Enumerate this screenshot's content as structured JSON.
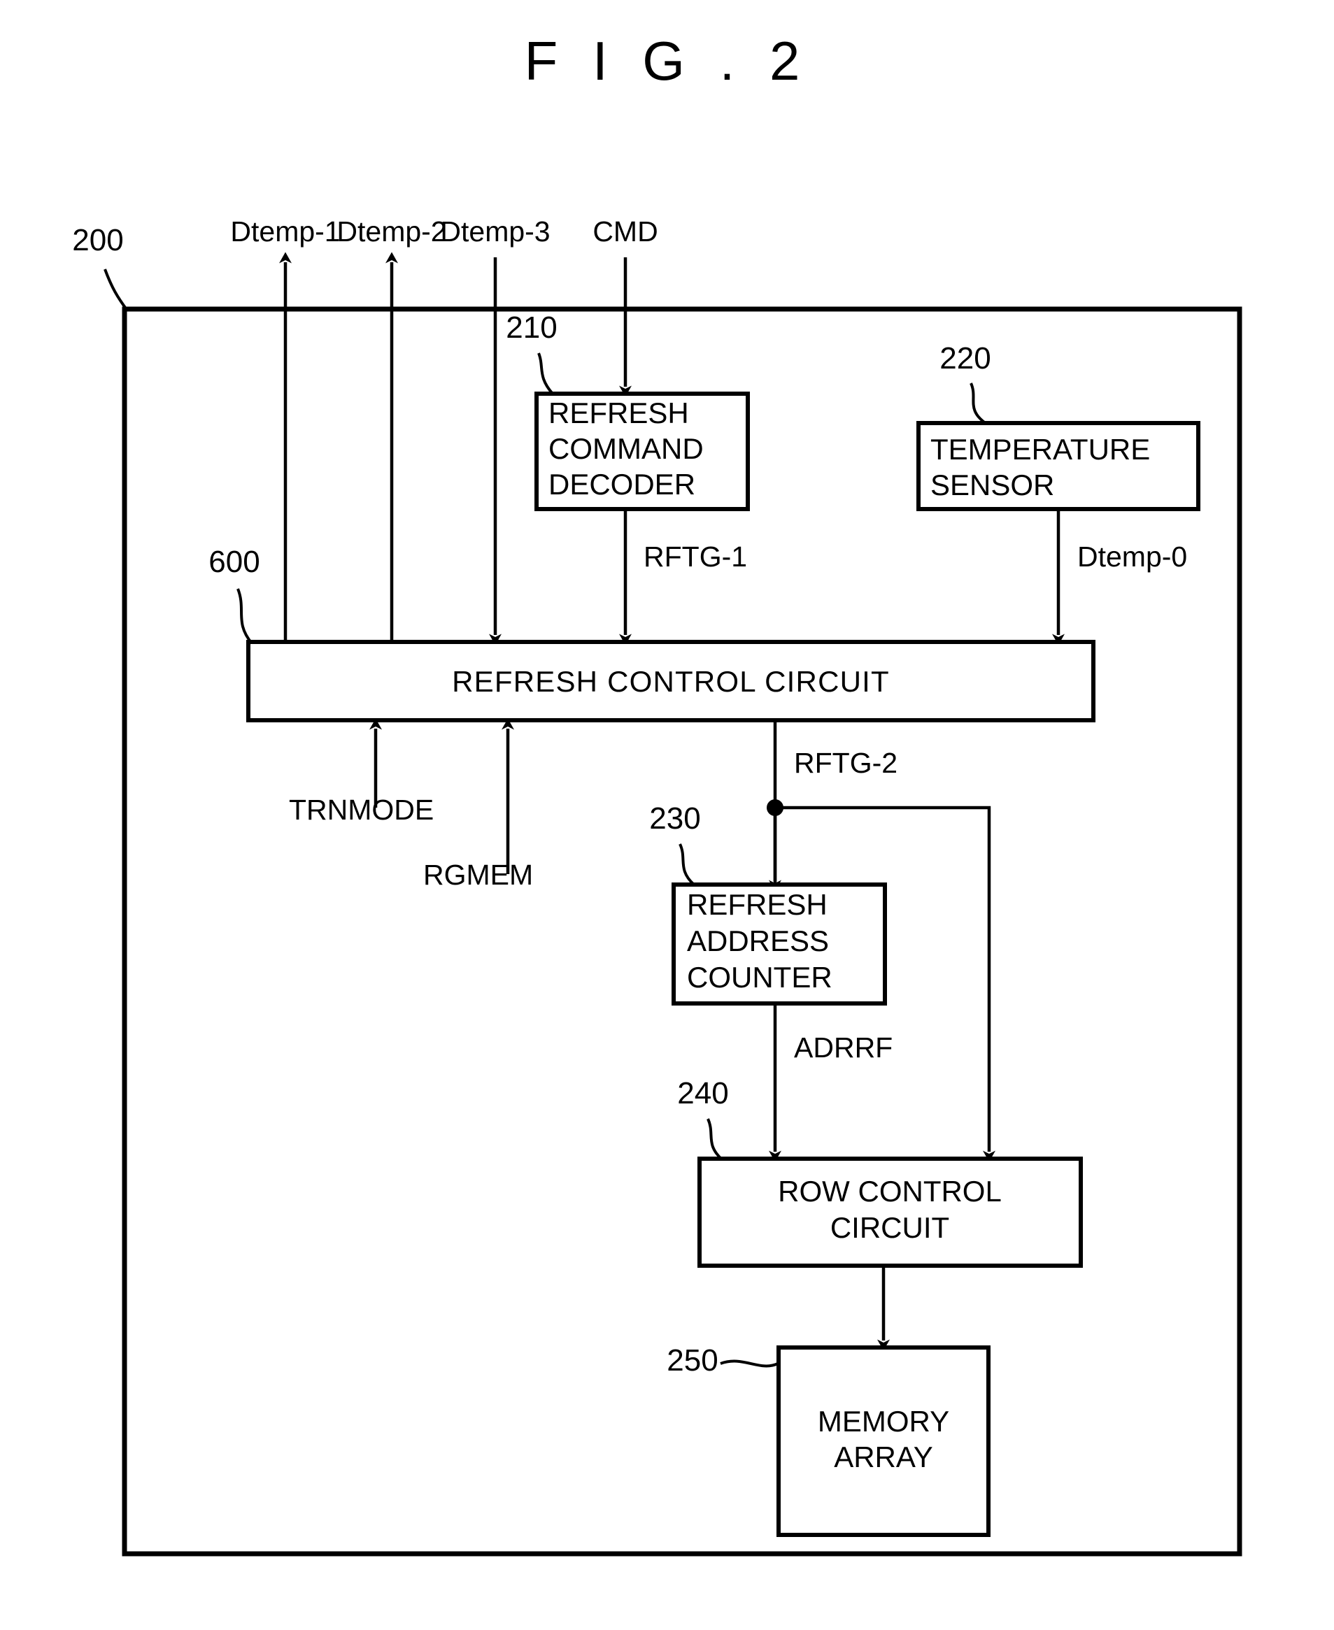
{
  "figure": {
    "title": "F I G . 2",
    "outer_ref": "200"
  },
  "signals": {
    "dtemp1": "Dtemp-1",
    "dtemp2": "Dtemp-2",
    "dtemp3": "Dtemp-3",
    "cmd": "CMD",
    "rftg1": "RFTG-1",
    "dtemp0": "Dtemp-0",
    "rftg2": "RFTG-2",
    "trnmode": "TRNMODE",
    "rgmem": "RGMEM",
    "adrrf": "ADRRF"
  },
  "blocks": [
    {
      "ref": "210",
      "lines": [
        "REFRESH",
        "COMMAND",
        "DECODER"
      ]
    },
    {
      "ref": "220",
      "lines": [
        "TEMPERATURE",
        "SENSOR"
      ]
    },
    {
      "ref": "600",
      "lines": [
        "REFRESH CONTROL CIRCUIT"
      ]
    },
    {
      "ref": "230",
      "lines": [
        "REFRESH",
        "ADDRESS",
        "COUNTER"
      ]
    },
    {
      "ref": "240",
      "lines": [
        "ROW CONTROL",
        "CIRCUIT"
      ]
    },
    {
      "ref": "250",
      "lines": [
        "MEMORY",
        "ARRAY"
      ]
    }
  ],
  "colors": {
    "ink": "#000000",
    "paper": "#ffffff"
  }
}
